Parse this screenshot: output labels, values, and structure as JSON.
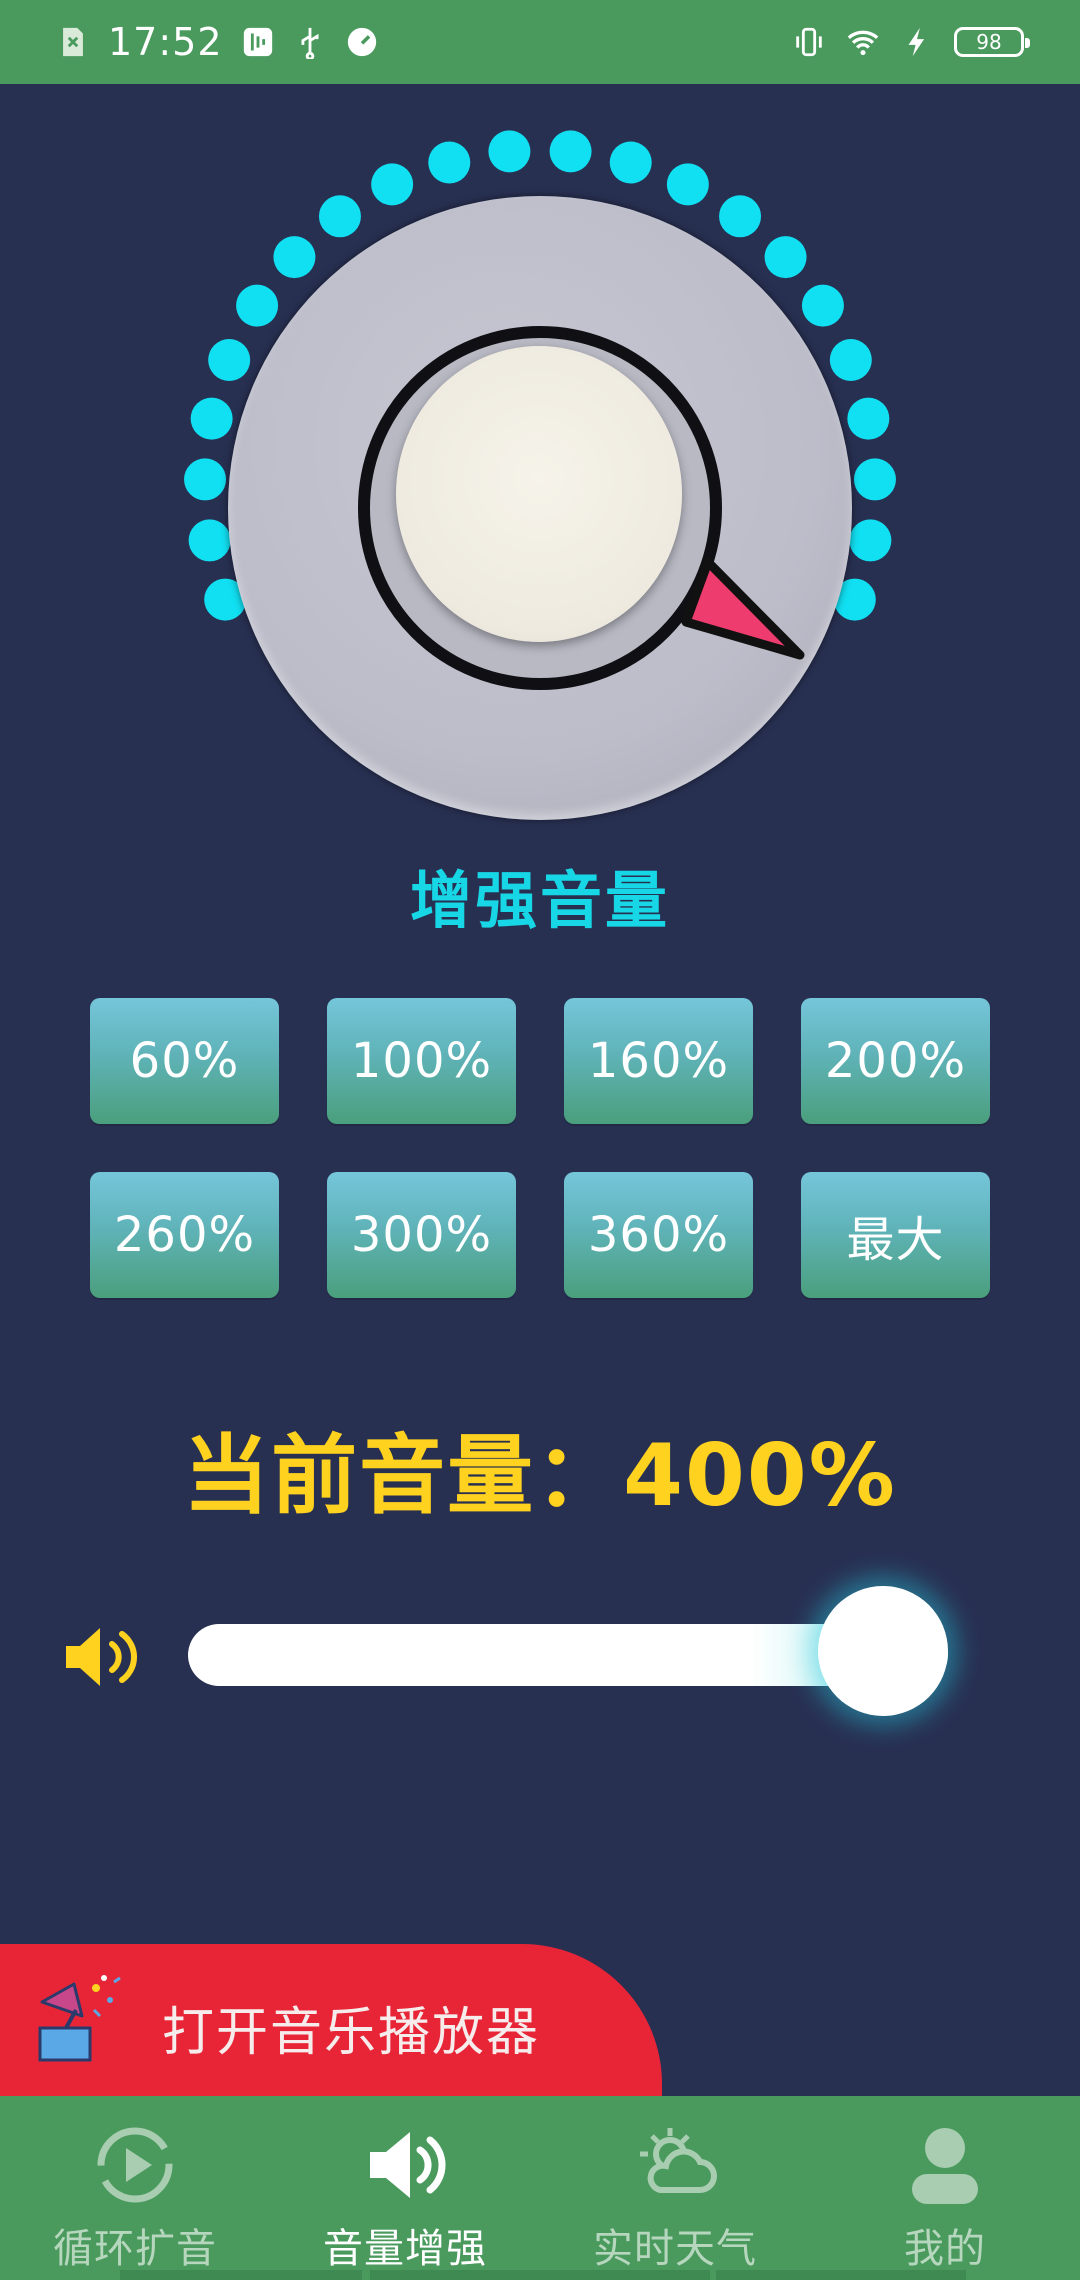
{
  "status_bar": {
    "time": "17:52",
    "battery": "98"
  },
  "title": "增强音量",
  "presets": [
    "60%",
    "100%",
    "160%",
    "200%",
    "260%",
    "300%",
    "360%",
    "最大"
  ],
  "current_volume": {
    "label": "当前音量：",
    "value": "400%"
  },
  "slider": {
    "level_fraction": 1.0
  },
  "music_button": {
    "label": "打开音乐播放器"
  },
  "nav": [
    {
      "label": "循环扩音",
      "icon": "loop-play-icon",
      "active": false
    },
    {
      "label": "音量增强",
      "icon": "speaker-icon",
      "active": true
    },
    {
      "label": "实时天气",
      "icon": "weather-icon",
      "active": false
    },
    {
      "label": "我的",
      "icon": "person-icon",
      "active": false
    }
  ],
  "colors": {
    "status_green": "#4a9a5e",
    "background": "#283052",
    "accent_cyan": "#17d7e6",
    "volume_yellow": "#ffd21f",
    "banner_red": "#e82537"
  }
}
